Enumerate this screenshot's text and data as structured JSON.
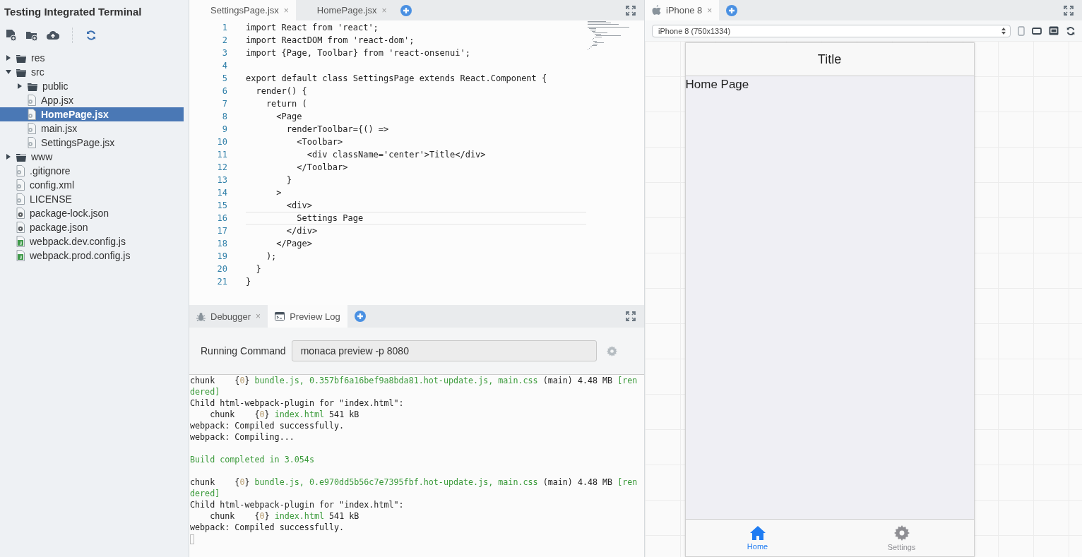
{
  "project": {
    "title": "Testing Integrated Terminal"
  },
  "file_tree": [
    {
      "name": "res",
      "kind": "folder",
      "expanded": false,
      "selected": false
    },
    {
      "name": "src",
      "kind": "folder",
      "expanded": true,
      "selected": false,
      "children": [
        {
          "name": "public",
          "kind": "folder",
          "expanded": false,
          "selected": false
        },
        {
          "name": "App.jsx",
          "kind": "file",
          "selected": false
        },
        {
          "name": "HomePage.jsx",
          "kind": "file",
          "selected": true
        },
        {
          "name": "main.jsx",
          "kind": "file",
          "selected": false
        },
        {
          "name": "SettingsPage.jsx",
          "kind": "file",
          "selected": false
        }
      ]
    },
    {
      "name": "www",
      "kind": "folder",
      "expanded": false,
      "selected": false
    },
    {
      "name": ".gitignore",
      "kind": "file",
      "selected": false
    },
    {
      "name": "config.xml",
      "kind": "file",
      "selected": false
    },
    {
      "name": "LICENSE",
      "kind": "file",
      "selected": false
    },
    {
      "name": "package-lock.json",
      "kind": "package",
      "selected": false
    },
    {
      "name": "package.json",
      "kind": "package",
      "selected": false
    },
    {
      "name": "webpack.dev.config.js",
      "kind": "js",
      "selected": false
    },
    {
      "name": "webpack.prod.config.js",
      "kind": "js",
      "selected": false
    }
  ],
  "editor_tabs": [
    {
      "label": "SettingsPage.jsx",
      "close": "×",
      "selected": true
    },
    {
      "label": "HomePage.jsx",
      "close": "×",
      "selected": false
    }
  ],
  "code_lines": [
    {
      "number": "1",
      "text": "import React from 'react';",
      "current": false
    },
    {
      "number": "2",
      "text": "import ReactDOM from 'react-dom';",
      "current": false
    },
    {
      "number": "3",
      "text": "import {Page, Toolbar} from 'react-onsenui';",
      "current": false
    },
    {
      "number": "4",
      "current": false
    },
    {
      "number": "5",
      "text": "export default class SettingsPage extends React.Component {",
      "current": false
    },
    {
      "number": "6",
      "text": "  render() {",
      "current": false
    },
    {
      "number": "7",
      "text": "    return (",
      "current": false
    },
    {
      "number": "8",
      "text": "      <Page",
      "current": false
    },
    {
      "number": "9",
      "text": "        renderToolbar={() =>",
      "current": false
    },
    {
      "number": "10",
      "text": "          <Toolbar>",
      "current": false
    },
    {
      "number": "11",
      "text": "            <div className='center'>Title</div>",
      "current": false
    },
    {
      "number": "12",
      "text": "          </Toolbar>",
      "current": false
    },
    {
      "number": "13",
      "text": "        }",
      "current": false
    },
    {
      "number": "14",
      "text": "      >",
      "current": false
    },
    {
      "number": "15",
      "text": "        <div>",
      "current": false
    },
    {
      "number": "16",
      "text": "          Settings Page",
      "current": true
    },
    {
      "number": "17",
      "text": "        </div>",
      "current": false
    },
    {
      "number": "18",
      "text": "      </Page>",
      "current": false
    },
    {
      "number": "19",
      "text": "    );",
      "current": false
    },
    {
      "number": "20",
      "text": "  }",
      "current": false
    },
    {
      "number": "21",
      "text": "}",
      "current": false
    }
  ],
  "panel_tabs": [
    {
      "label": "Debugger",
      "kind": "bug",
      "close": "×",
      "selected": false
    },
    {
      "label": "Preview Log",
      "kind": "log",
      "selected": true
    }
  ],
  "running_command": {
    "label": "Running Command",
    "value": "monaca preview -p 8080"
  },
  "log_lines": [
    {
      "segments": [
        {
          "kind": "plain",
          "text": "chunk    {"
        },
        {
          "kind": "number",
          "text": "0"
        },
        {
          "kind": "plain",
          "text": "} "
        },
        {
          "kind": "green",
          "text": "bundle.js, 0.357bf6a16bef9a8bda81.hot-update.js, main.css"
        },
        {
          "kind": "plain",
          "text": " (main) 4.48 MB "
        },
        {
          "kind": "green",
          "text": "[ren"
        }
      ]
    },
    {
      "segments": [
        {
          "kind": "green",
          "text": "dered]"
        }
      ]
    },
    {
      "segments": [
        {
          "kind": "plain",
          "text": "Child html-webpack-plugin for \"index.html\":"
        }
      ]
    },
    {
      "segments": [
        {
          "kind": "plain",
          "text": "    chunk    {"
        },
        {
          "kind": "number",
          "text": "0"
        },
        {
          "kind": "plain",
          "text": "} "
        },
        {
          "kind": "green",
          "text": "index.html"
        },
        {
          "kind": "plain",
          "text": " 541 kB"
        }
      ]
    },
    {
      "segments": [
        {
          "kind": "plain",
          "text": "webpack: Compiled successfully."
        }
      ]
    },
    {
      "segments": [
        {
          "kind": "plain",
          "text": "webpack: Compiling..."
        }
      ]
    },
    {
      "gap_before": true,
      "segments": [
        {
          "kind": "green",
          "text": "Build completed in 3.054s"
        }
      ]
    },
    {
      "gap_before": true,
      "segments": [
        {
          "kind": "plain",
          "text": "chunk    {"
        },
        {
          "kind": "number",
          "text": "0"
        },
        {
          "kind": "plain",
          "text": "} "
        },
        {
          "kind": "green",
          "text": "bundle.js, 0.e970dd5b56c7e7395fbf.hot-update.js, main.css"
        },
        {
          "kind": "plain",
          "text": " (main) 4.48 MB "
        },
        {
          "kind": "green",
          "text": "[ren"
        }
      ]
    },
    {
      "segments": [
        {
          "kind": "green",
          "text": "dered]"
        }
      ]
    },
    {
      "segments": [
        {
          "kind": "plain",
          "text": "Child html-webpack-plugin for \"index.html\":"
        }
      ]
    },
    {
      "segments": [
        {
          "kind": "plain",
          "text": "    chunk    {"
        },
        {
          "kind": "number",
          "text": "0"
        },
        {
          "kind": "plain",
          "text": "} "
        },
        {
          "kind": "green",
          "text": "index.html"
        },
        {
          "kind": "plain",
          "text": " 541 kB"
        }
      ]
    },
    {
      "segments": [
        {
          "kind": "plain",
          "text": "webpack: Compiled successfully."
        }
      ]
    }
  ],
  "preview_tab": {
    "label": "iPhone 8",
    "close": "×",
    "selected": true
  },
  "device_select": {
    "value": "iPhone 8 (750x1334)"
  },
  "app": {
    "toolbar_title": "Title",
    "content": "Home Page",
    "tabs": [
      {
        "label": "Home",
        "kind": "home",
        "selected": true
      },
      {
        "label": "Settings",
        "kind": "gear",
        "selected": false
      }
    ]
  }
}
